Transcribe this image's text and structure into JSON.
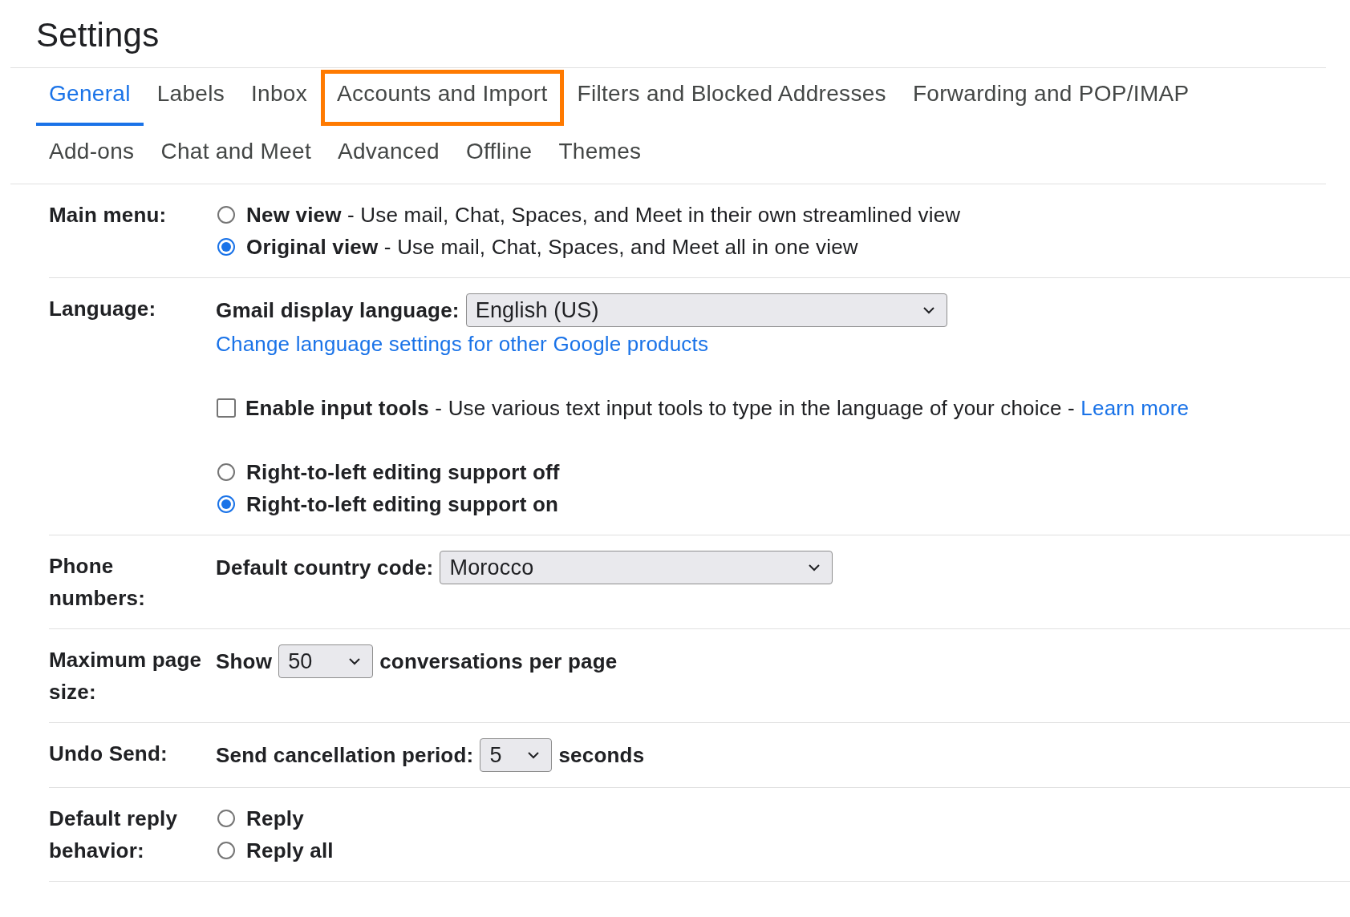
{
  "title": "Settings",
  "tab_rows": [
    [
      {
        "label": "General",
        "selected": true,
        "highlighted": false
      },
      {
        "label": "Labels",
        "selected": false,
        "highlighted": false
      },
      {
        "label": "Inbox",
        "selected": false,
        "highlighted": false
      },
      {
        "label": "Accounts and Import",
        "selected": false,
        "highlighted": true
      },
      {
        "label": "Filters and Blocked Addresses",
        "selected": false,
        "highlighted": false
      },
      {
        "label": "Forwarding and POP/IMAP",
        "selected": false,
        "highlighted": false
      }
    ],
    [
      {
        "label": "Add-ons",
        "selected": false,
        "highlighted": false
      },
      {
        "label": "Chat and Meet",
        "selected": false,
        "highlighted": false
      },
      {
        "label": "Advanced",
        "selected": false,
        "highlighted": false
      },
      {
        "label": "Offline",
        "selected": false,
        "highlighted": false
      },
      {
        "label": "Themes",
        "selected": false,
        "highlighted": false
      }
    ]
  ],
  "sections": [
    {
      "label": "Main menu:",
      "blocks": [
        {
          "kind": "radios",
          "options": [
            {
              "title": "New view",
              "description": "- Use mail, Chat, Spaces, and Meet in their own streamlined view",
              "selected": false
            },
            {
              "title": "Original view",
              "description": "- Use mail, Chat, Spaces, and Meet all in one view",
              "selected": true
            }
          ]
        }
      ]
    },
    {
      "label": "Language:",
      "blocks": [
        {
          "kind": "select",
          "before": "Gmail display language:",
          "value": "English (US)"
        },
        {
          "kind": "link",
          "text": "Change language settings for other Google products"
        },
        {
          "kind": "checkbox",
          "title": "Enable input tools",
          "description": "- Use various text input tools to type in the language of your choice -",
          "link": "Learn more",
          "checked": false
        },
        {
          "kind": "radios",
          "options": [
            {
              "title": "Right-to-left editing support off",
              "selected": false
            },
            {
              "title": "Right-to-left editing support on",
              "selected": true
            }
          ]
        }
      ]
    },
    {
      "label": "Phone numbers:",
      "blocks": [
        {
          "kind": "select",
          "before": "Default country code:",
          "value": "Morocco"
        }
      ]
    },
    {
      "label": "Maximum page size:",
      "blocks": [
        {
          "kind": "select",
          "before": "Show",
          "value": "50",
          "after": "conversations per page"
        }
      ]
    },
    {
      "label": "Undo Send:",
      "blocks": [
        {
          "kind": "select",
          "before": "Send cancellation period:",
          "value": "5",
          "after": "seconds"
        }
      ]
    },
    {
      "label": "Default reply behavior:",
      "blocks": [
        {
          "kind": "radios",
          "options": [
            {
              "title": "Reply",
              "selected": false
            },
            {
              "title": "Reply all",
              "selected": false
            }
          ]
        }
      ]
    }
  ]
}
